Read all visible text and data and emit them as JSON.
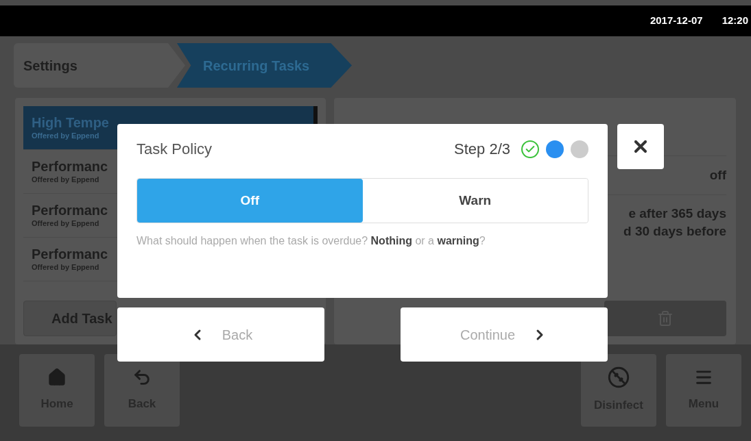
{
  "status_bar": {
    "date": "2017-12-07",
    "time": "12:20"
  },
  "breadcrumb": [
    {
      "label": "Settings",
      "selected": false
    },
    {
      "label": "Recurring Tasks",
      "selected": true
    }
  ],
  "task_list": {
    "items": [
      {
        "title": "High Tempe",
        "subtitle": "Offered by Eppend",
        "selected": true
      },
      {
        "title": "Performanc",
        "subtitle": "Offered by Eppend",
        "selected": false
      },
      {
        "title": "Performanc",
        "subtitle": "Offered by Eppend",
        "selected": false
      },
      {
        "title": "Performanc",
        "subtitle": "Offered by Eppend",
        "selected": false
      }
    ],
    "add_button": "Add Task"
  },
  "detail": {
    "value": "off",
    "description": [
      "e after 365 days",
      "d 30 days before"
    ]
  },
  "dialog": {
    "title": "Task Policy",
    "step": "Step 2/3",
    "steps": [
      {
        "kind": "done"
      },
      {
        "kind": "current"
      },
      {
        "kind": "pending"
      }
    ],
    "options": [
      {
        "label": "Off",
        "selected": true
      },
      {
        "label": "Warn",
        "selected": false
      }
    ],
    "hint": "What should happen when the task is overdue? **Nothing** or a **warning**?",
    "back_button": "Back",
    "continue_button": "Continue"
  },
  "bottom_nav": {
    "left": [
      {
        "label": "Home",
        "kind": "home"
      },
      {
        "label": "Back",
        "kind": "back"
      }
    ],
    "right": [
      {
        "label": "Disinfect",
        "kind": "disinfect"
      },
      {
        "label": "Menu",
        "kind": "menu"
      }
    ]
  }
}
